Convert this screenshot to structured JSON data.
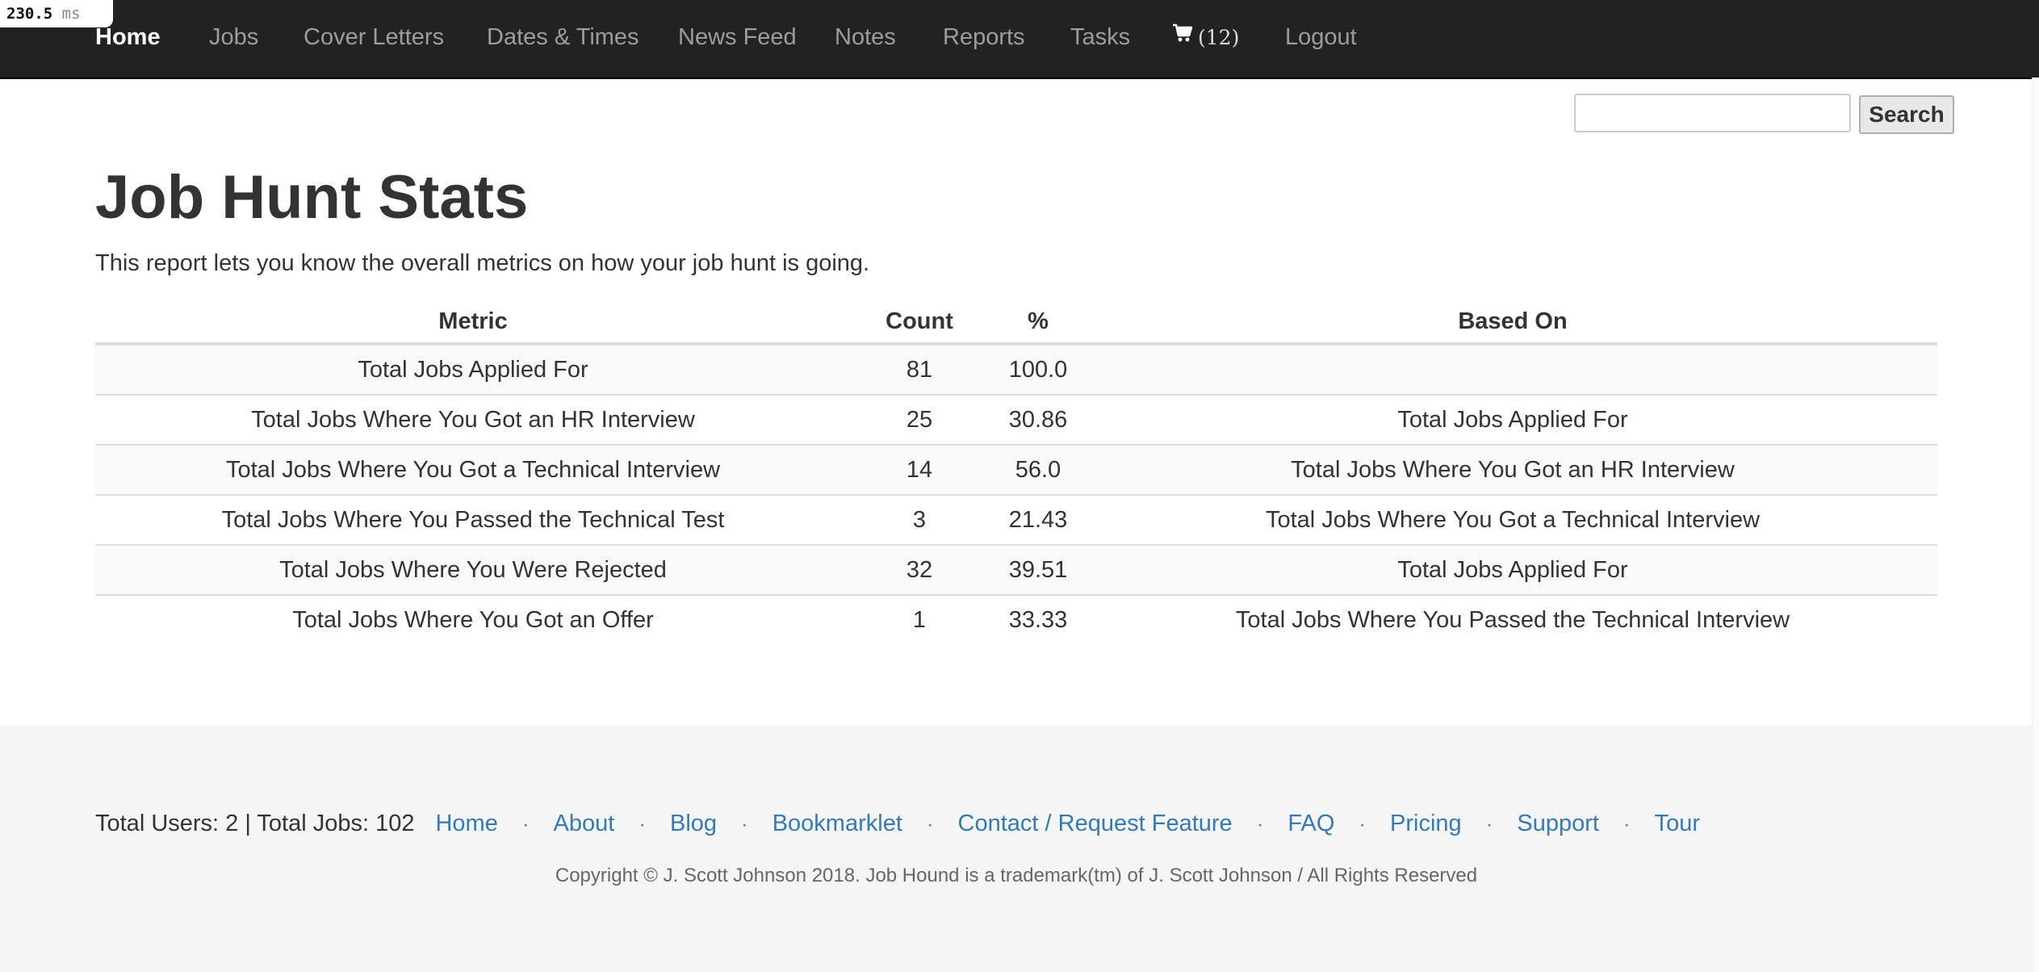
{
  "timer": {
    "value": "230.5",
    "unit": "ms"
  },
  "nav": {
    "home": "Home",
    "jobs": "Jobs",
    "cover_letters": "Cover Letters",
    "dates_times": "Dates & Times",
    "news_feed": "News Feed",
    "notes": "Notes",
    "reports": "Reports",
    "tasks": "Tasks",
    "cart_count": "(12)",
    "cart_icon": "cart-icon",
    "logout": "Logout"
  },
  "search": {
    "value": "",
    "button_label": "Search"
  },
  "page": {
    "title": "Job Hunt Stats",
    "description": "This report lets you know the overall metrics on how your job hunt is going."
  },
  "table": {
    "headers": {
      "metric": "Metric",
      "count": "Count",
      "percent": "%",
      "based_on": "Based On"
    },
    "rows": [
      {
        "metric": "Total Jobs Applied For",
        "count": "81",
        "percent": "100.0",
        "based_on": ""
      },
      {
        "metric": "Total Jobs Where You Got an HR Interview",
        "count": "25",
        "percent": "30.86",
        "based_on": "Total Jobs Applied For"
      },
      {
        "metric": "Total Jobs Where You Got a Technical Interview",
        "count": "14",
        "percent": "56.0",
        "based_on": "Total Jobs Where You Got an HR Interview"
      },
      {
        "metric": "Total Jobs Where You Passed the Technical Test",
        "count": "3",
        "percent": "21.43",
        "based_on": "Total Jobs Where You Got a Technical Interview"
      },
      {
        "metric": "Total Jobs Where You Were Rejected",
        "count": "32",
        "percent": "39.51",
        "based_on": "Total Jobs Applied For"
      },
      {
        "metric": "Total Jobs Where You Got an Offer",
        "count": "1",
        "percent": "33.33",
        "based_on": "Total Jobs Where You Passed the Technical Interview"
      }
    ]
  },
  "footer": {
    "stats": "Total Users: 2 | Total Jobs: 102",
    "separator": "·",
    "links": [
      "Home",
      "About",
      "Blog",
      "Bookmarklet",
      "Contact / Request Feature",
      "FAQ",
      "Pricing",
      "Support",
      "Tour"
    ],
    "copyright": "Copyright © J. Scott Johnson 2018. Job Hound is a trademark(tm) of J. Scott Johnson / All Rights Reserved"
  },
  "colors": {
    "navbar": "#222222",
    "nav_text": "#9d9d9d",
    "link": "#337ab7",
    "footer_bg": "#f5f5f5"
  }
}
